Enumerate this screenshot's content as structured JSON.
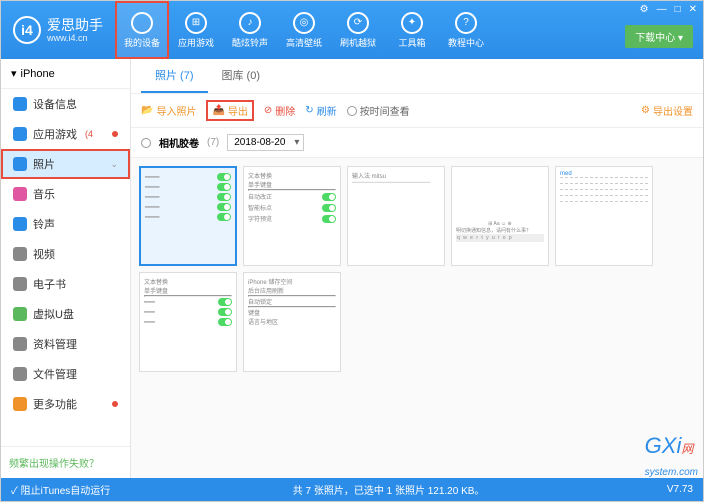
{
  "app": {
    "name": "爱思助手",
    "url": "www.i4.cn"
  },
  "window_controls": {
    "settings": "⚙",
    "min": "—",
    "max": "□",
    "close": "✕"
  },
  "download_center": "下载中心 ▾",
  "nav": [
    {
      "icon": "",
      "label": "我的设备",
      "active": true
    },
    {
      "icon": "⊞",
      "label": "应用游戏"
    },
    {
      "icon": "♪",
      "label": "酷炫铃声"
    },
    {
      "icon": "◎",
      "label": "高清壁纸"
    },
    {
      "icon": "⟳",
      "label": "刷机越狱"
    },
    {
      "icon": "✦",
      "label": "工具箱"
    },
    {
      "icon": "?",
      "label": "教程中心"
    }
  ],
  "device": {
    "name": "iPhone"
  },
  "sidebar": [
    {
      "label": "设备信息",
      "color": "#2c8de8"
    },
    {
      "label": "应用游戏",
      "color": "#2c8de8",
      "badge": "4"
    },
    {
      "label": "照片",
      "color": "#2c8de8",
      "selected": true
    },
    {
      "label": "音乐",
      "color": "#e056a0"
    },
    {
      "label": "铃声",
      "color": "#2c8de8"
    },
    {
      "label": "视频",
      "color": "#888"
    },
    {
      "label": "电子书",
      "color": "#888"
    },
    {
      "label": "虚拟U盘",
      "color": "#5cb85c"
    },
    {
      "label": "资料管理",
      "color": "#888"
    },
    {
      "label": "文件管理",
      "color": "#888"
    },
    {
      "label": "更多功能",
      "color": "#f0932b",
      "badge": "●"
    }
  ],
  "side_footer": "频繁出现操作失败？",
  "tabs": [
    {
      "label": "照片 (7)",
      "active": true
    },
    {
      "label": "图库 (0)"
    }
  ],
  "toolbar": {
    "import": "导入照片",
    "export": "导出",
    "delete": "删除",
    "refresh": "刷新",
    "sort_time": "按时间查看",
    "export_settings": "导出设置"
  },
  "filter": {
    "album": "相机胶卷",
    "count": "(7)",
    "date": "2018-08-20"
  },
  "thumbs": {
    "t3_title": "输入法  mitsu",
    "t4_hint": "明切换通知信息，请问有什么事？",
    "t4_keys": "q w e r t y u i o p",
    "t5_label": "med",
    "settings_items": [
      "文本替换",
      "单手键盘",
      "自动改正",
      "智能标点",
      "字符预览"
    ],
    "settings_items_b": [
      "iPhone 储存空间",
      "后台应用刷新",
      "自动锁定",
      "键盘",
      "语言与地区"
    ]
  },
  "statusbar": {
    "itunes": "阻止iTunes自动运行",
    "info": "共 7 张照片，已选中 1 张照片 121.20 KB。",
    "version": "V7.73"
  },
  "watermark": {
    "main": "GXi",
    "sub": "system.com",
    "net": "网"
  }
}
